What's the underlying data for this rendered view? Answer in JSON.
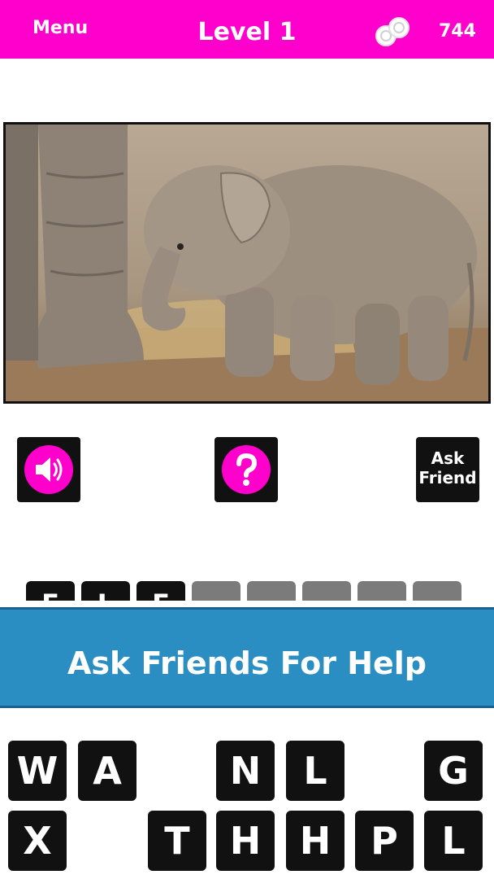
{
  "topbar": {
    "menu_label": "Menu",
    "level_title": "Level 1",
    "coin_count": "744",
    "bar_color": "#ff00cc"
  },
  "picture": {
    "subject": "baby elephant photo"
  },
  "hints": {
    "sound_icon": "speaker-icon",
    "help_icon": "question-icon",
    "ask_friend_line1": "Ask",
    "ask_friend_line2": "Friend"
  },
  "answer": {
    "letters": [
      "E",
      "L",
      "E",
      "",
      "",
      "",
      "",
      ""
    ]
  },
  "banner": {
    "text": "Ask Friends For Help",
    "color": "#2a8ec3"
  },
  "keyboard": {
    "row1": [
      "W",
      "A",
      "",
      "N",
      "L",
      "",
      "G"
    ],
    "row2": [
      "X",
      "",
      "T",
      "H",
      "H",
      "P",
      "L"
    ]
  }
}
